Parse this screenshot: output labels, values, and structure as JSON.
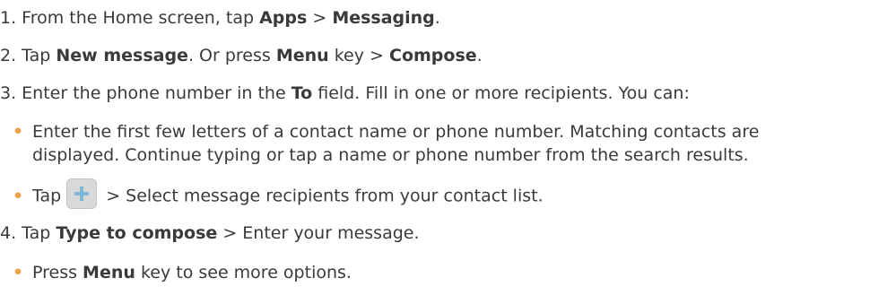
{
  "steps": [
    {
      "prefix": "1. From the Home screen, tap ",
      "b1": "Apps",
      "mid": " > ",
      "b2": "Messaging",
      "suffix": "."
    },
    {
      "prefix": "2. Tap ",
      "b1": "New message",
      "mid": ". Or press ",
      "b2": "Menu",
      "mid2": " key > ",
      "b3": "Compose",
      "suffix": "."
    },
    {
      "prefix": "3. Enter the phone number in the ",
      "b1": "To",
      "suffix": " field. Fill in one or more recipients. You can:"
    },
    {
      "prefix": "4. Tap ",
      "b1": "Type to compose",
      "suffix": " > Enter your message."
    }
  ],
  "bullets": [
    {
      "line1": "Enter the first few letters of a contact name or phone number. Matching contacts are",
      "line2": "displayed. Continue typing or tap a name or phone number from the search results."
    },
    {
      "prefix": "Tap",
      "icon": "add-recipient-icon",
      "suffix": " > Select message recipients from your contact list."
    },
    {
      "prefix": "Press ",
      "b1": "Menu",
      "suffix": " key to see more options."
    }
  ],
  "bullet_color": "#f0a14a"
}
